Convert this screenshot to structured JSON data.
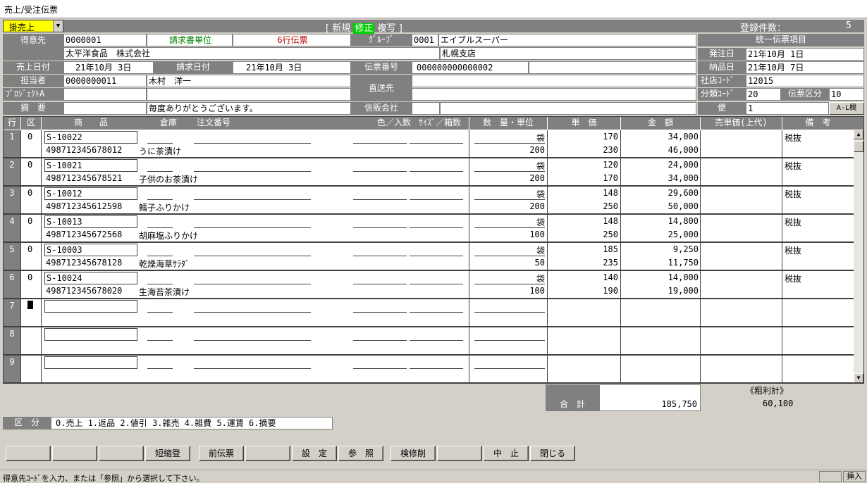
{
  "window_title": "売上/受注伝票",
  "mode_select": "掛売上",
  "header": {
    "bracket_open": "[",
    "mode_new": "新規",
    "mode_edit": "修正",
    "mode_copy": "複写",
    "bracket_close": "]",
    "count_label": "登録件数：",
    "count_value": "5"
  },
  "customer": {
    "label": "得意先",
    "code": "0000001",
    "billing_unit": "請求書単位",
    "slip_type": "6行伝票",
    "name": "太平洋食品　株式会社"
  },
  "group": {
    "label": "ｸﾞﾙｰﾌﾟ",
    "code": "0001",
    "name": "エイブルスーパー",
    "branch": "札幌支店"
  },
  "sales_date": {
    "label": "売上日付",
    "value": "21年10月 3日"
  },
  "billing_date": {
    "label": "請求日付",
    "value": "21年10月 3日"
  },
  "slip_number": {
    "label": "伝票番号",
    "value": "000000000000002"
  },
  "staff": {
    "label": "担当者",
    "code": "0000000011",
    "name": "木村　洋一"
  },
  "project": {
    "label": "ﾌﾟﾛｼﾞｪｸﾄA"
  },
  "direct_ship": {
    "label": "直送先"
  },
  "memo": {
    "label": "摘　要",
    "value": "毎度ありがとうございます。"
  },
  "mail_order": {
    "label": "信販会社"
  },
  "unified": {
    "title": "統一伝票項目",
    "order_date_label": "発注日",
    "order_date": "21年10月 1日",
    "delivery_date_label": "納品日",
    "delivery_date": "21年10月 7日",
    "store_code_label": "社店ｺｰﾄﾞ",
    "store_code": "12015",
    "class_code_label": "分類ｺｰﾄﾞ",
    "class_code": "20",
    "slip_class_label": "伝票区分",
    "slip_class": "10",
    "bin_label": "便",
    "bin": "1",
    "al_button": "A-L欄"
  },
  "columns": {
    "row": "行",
    "kbn": "区",
    "product": "商　　品",
    "warehouse": "倉庫",
    "order_no": "注文番号",
    "color": "色／入数",
    "size": "ｻｲｽﾞ／箱数",
    "qty": "数　量・単位",
    "price": "単　価",
    "amount": "金　額",
    "retail": "売単価(上代)",
    "note": "備　考"
  },
  "rows": [
    {
      "no": "1",
      "kbn": "0",
      "code": "S-10022",
      "jan": "498712345678012",
      "name": "うに茶漬け",
      "unit": "袋",
      "qty": "200",
      "price": "170",
      "cost": "230",
      "amount": "34,000",
      "amount2": "46,000",
      "note": "税抜"
    },
    {
      "no": "2",
      "kbn": "0",
      "code": "S-10021",
      "jan": "498712345678521",
      "name": "子供のお茶漬け",
      "unit": "袋",
      "qty": "200",
      "price": "120",
      "cost": "170",
      "amount": "24,000",
      "amount2": "34,000",
      "note": "税抜"
    },
    {
      "no": "3",
      "kbn": "0",
      "code": "S-10012",
      "jan": "498712345612598",
      "name": "鱈子ふりかけ",
      "unit": "袋",
      "qty": "200",
      "price": "148",
      "cost": "250",
      "amount": "29,600",
      "amount2": "50,000",
      "note": "税抜"
    },
    {
      "no": "4",
      "kbn": "0",
      "code": "S-10013",
      "jan": "498712345672568",
      "name": "胡麻塩ふりかけ",
      "unit": "袋",
      "qty": "100",
      "price": "148",
      "cost": "250",
      "amount": "14,800",
      "amount2": "25,000",
      "note": "税抜"
    },
    {
      "no": "5",
      "kbn": "0",
      "code": "S-10003",
      "jan": "498712345678128",
      "name": "乾燥海草ｻﾗﾀﾞ",
      "unit": "袋",
      "qty": "50",
      "price": "185",
      "cost": "235",
      "amount": "9,250",
      "amount2": "11,750",
      "note": "税抜"
    },
    {
      "no": "6",
      "kbn": "0",
      "code": "S-10024",
      "jan": "498712345678020",
      "name": "生海苔茶漬け",
      "unit": "袋",
      "qty": "100",
      "price": "140",
      "cost": "190",
      "amount": "14,000",
      "amount2": "19,000",
      "note": "税抜"
    },
    {
      "no": "7"
    },
    {
      "no": "8"
    },
    {
      "no": "9"
    }
  ],
  "total": {
    "label": "合　計",
    "value": "185,750",
    "profit_label": "《粗利計》",
    "profit_value": "60,100"
  },
  "kubun": {
    "label": "区　分",
    "legend": "0.売上  1.返品  2.値引  3.雑売  4.雑費  5.運賃  6.摘要"
  },
  "buttons": [
    "",
    "",
    "",
    "短縮登",
    "前伝票",
    "",
    "設　定",
    "参　照",
    "検修削",
    "",
    "中　止",
    "閉じる"
  ],
  "status": {
    "message": "得意先ｺｰﾄﾞを入力、または「参照」から選択して下さい。",
    "mode": "挿入"
  }
}
